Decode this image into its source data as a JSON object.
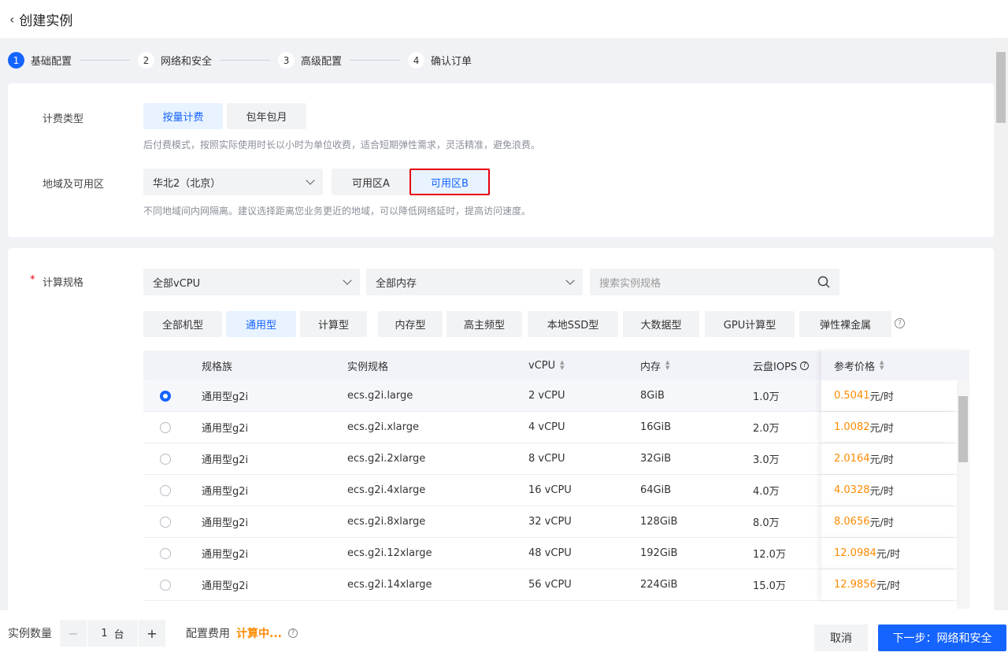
{
  "header": {
    "title": "创建实例"
  },
  "steps": [
    {
      "num": "1",
      "label": "基础配置"
    },
    {
      "num": "2",
      "label": "网络和安全"
    },
    {
      "num": "3",
      "label": "高级配置"
    },
    {
      "num": "4",
      "label": "确认订单"
    }
  ],
  "billing": {
    "label": "计费类型",
    "options": [
      "按量计费",
      "包年包月"
    ],
    "hint": "后付费模式，按照实际使用时长以小时为单位收费，适合短期弹性需求，灵活精准，避免浪费。"
  },
  "region": {
    "label": "地域及可用区",
    "value": "华北2（北京）",
    "zones": [
      "可用区A",
      "可用区B"
    ],
    "hint": "不同地域间内网隔离。建议选择距离您业务更近的地域，可以降低网络延时，提高访问速度。"
  },
  "spec": {
    "required": "*",
    "label": "计算规格",
    "vcpu_filter": "全部vCPU",
    "mem_filter": "全部内存",
    "search_placeholder": "搜索实例规格",
    "types": [
      "全部机型",
      "通用型",
      "计算型",
      "内存型",
      "高主频型",
      "本地SSD型",
      "大数据型",
      "GPU计算型",
      "弹性裸金属"
    ],
    "columns": [
      "规格族",
      "实例规格",
      "vCPU",
      "内存",
      "云盘IOPS",
      "参考价格"
    ],
    "unit": "元/时",
    "rows": [
      {
        "family": "通用型g2i",
        "spec": "ecs.g2i.large",
        "vcpu": "2 vCPU",
        "mem": "8GiB",
        "iops": "1.0万",
        "price": "0.5041"
      },
      {
        "family": "通用型g2i",
        "spec": "ecs.g2i.xlarge",
        "vcpu": "4 vCPU",
        "mem": "16GiB",
        "iops": "2.0万",
        "price": "1.0082"
      },
      {
        "family": "通用型g2i",
        "spec": "ecs.g2i.2xlarge",
        "vcpu": "8 vCPU",
        "mem": "32GiB",
        "iops": "3.0万",
        "price": "2.0164"
      },
      {
        "family": "通用型g2i",
        "spec": "ecs.g2i.4xlarge",
        "vcpu": "16 vCPU",
        "mem": "64GiB",
        "iops": "4.0万",
        "price": "4.0328"
      },
      {
        "family": "通用型g2i",
        "spec": "ecs.g2i.8xlarge",
        "vcpu": "32 vCPU",
        "mem": "128GiB",
        "iops": "8.0万",
        "price": "8.0656"
      },
      {
        "family": "通用型g2i",
        "spec": "ecs.g2i.12xlarge",
        "vcpu": "48 vCPU",
        "mem": "192GiB",
        "iops": "12.0万",
        "price": "12.0984"
      },
      {
        "family": "通用型g2i",
        "spec": "ecs.g2i.14xlarge",
        "vcpu": "56 vCPU",
        "mem": "224GiB",
        "iops": "15.0万",
        "price": "12.9856"
      }
    ]
  },
  "footer": {
    "qty_label": "实例数量",
    "qty": "1",
    "qty_unit": "台",
    "cost_label": "配置费用",
    "cost_value": "计算中...",
    "cancel": "取消",
    "next": "下一步：网络和安全"
  },
  "colors": {
    "accent": "#1664ff",
    "price": "#ff8a00",
    "highlight": "#e8000b"
  }
}
